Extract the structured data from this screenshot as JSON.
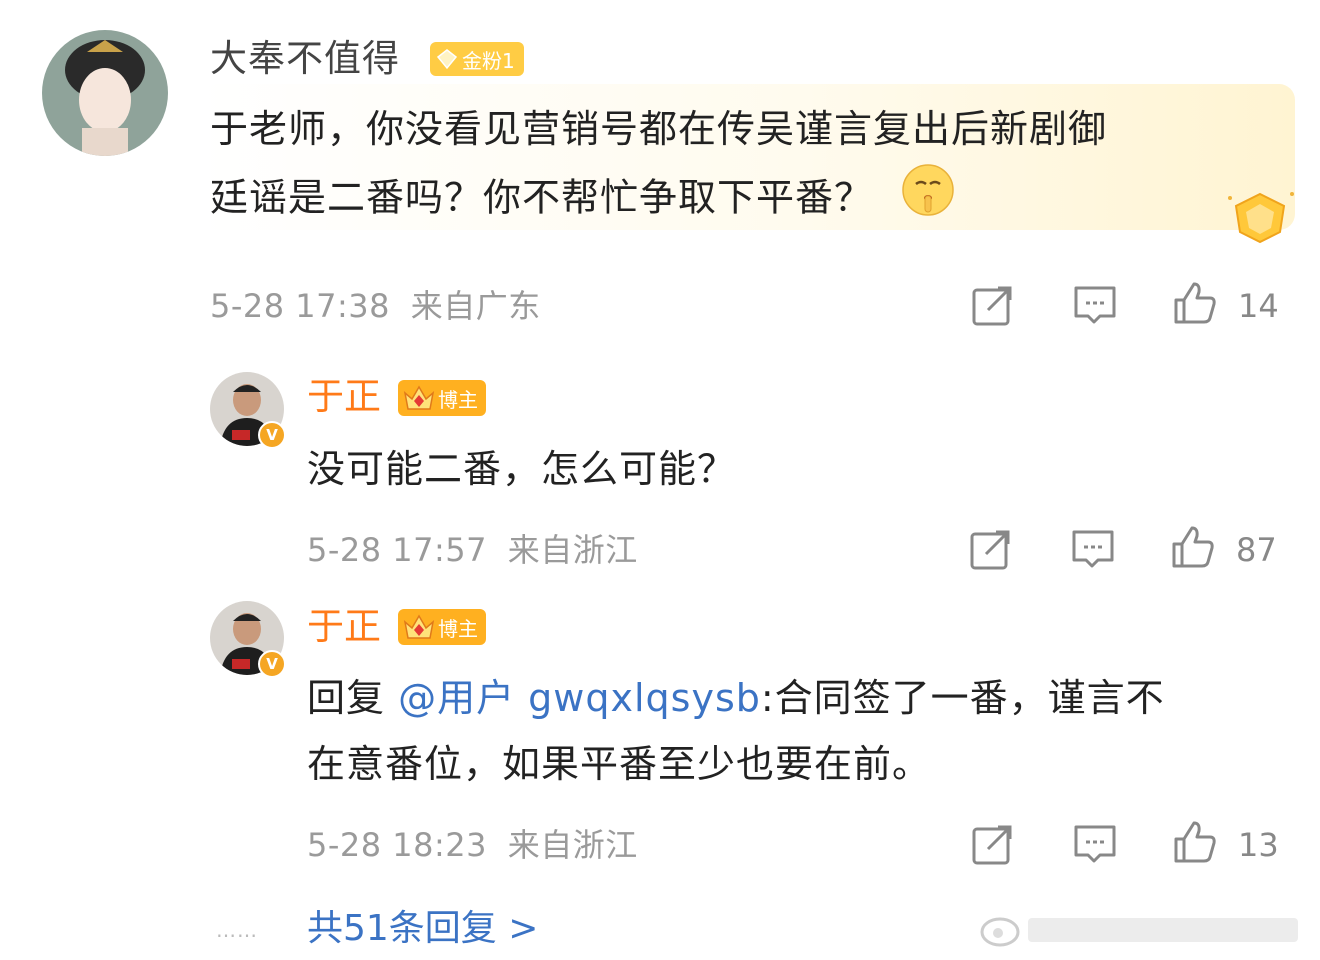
{
  "comment": {
    "username": "大奉不值得",
    "fan_badge": "金粉1",
    "text_line1": "于老师，你没看见营销号都在传吴谨言复出后新剧御",
    "text_line2": "廷谣是二番吗？你不帮忙争取下平番？",
    "emoji": "shush-face",
    "timestamp": "5-28 17:38",
    "location": "来自广东",
    "likes": "14"
  },
  "replies": [
    {
      "username": "于正",
      "badge": "博主",
      "text_line1": "没可能二番，怎么可能？",
      "timestamp": "5-28 17:57",
      "location": "来自浙江",
      "likes": "87"
    },
    {
      "username": "于正",
      "badge": "博主",
      "reply_prefix": "回复 ",
      "mention": "@用户 gwqxlqsysb",
      "text_after_mention": ":合同签了一番，谨言不",
      "text_line2": "在意番位，如果平番至少也要在前。",
      "timestamp": "5-28 18:23",
      "location": "来自浙江",
      "likes": "13"
    }
  ],
  "footer": {
    "dots": "……",
    "more_replies": "共51条回复 >"
  },
  "icons": [
    "share-icon",
    "comment-icon",
    "like-icon",
    "verified-v-icon",
    "crown-icon",
    "diamond-icon"
  ],
  "colors": {
    "blogger_name": "#ff7a18",
    "link": "#3b73c4",
    "badge_gold": "#ffcc44",
    "badge_blogger": "#ffb020"
  }
}
